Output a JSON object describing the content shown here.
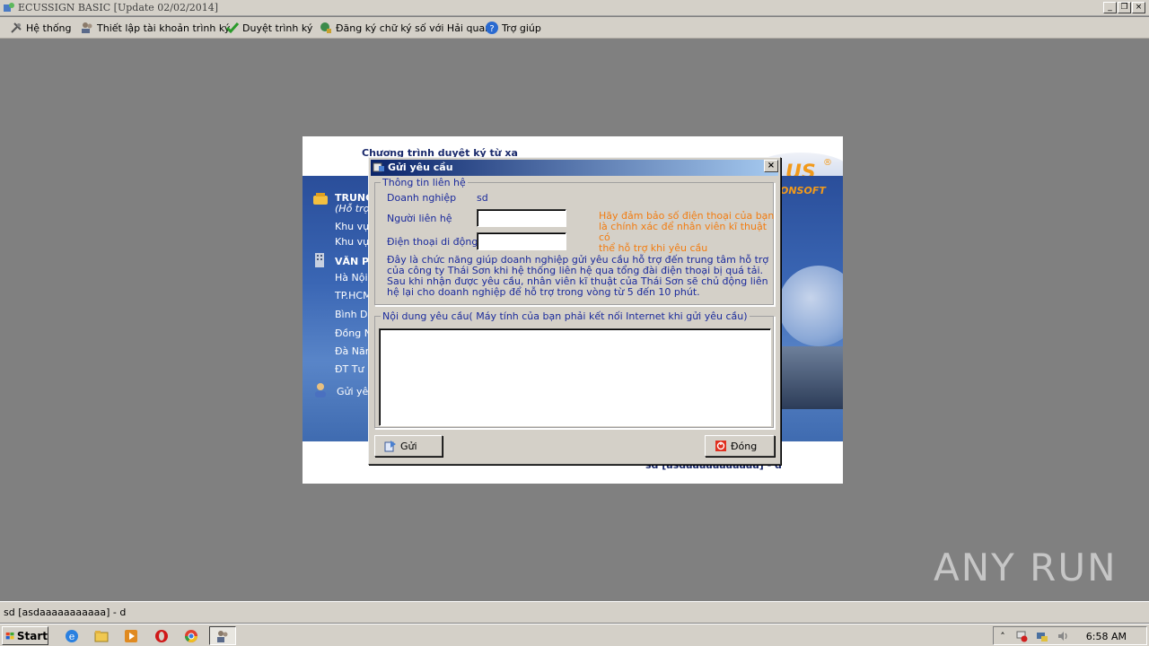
{
  "window": {
    "title": "ECUSSIGN BASIC [Update 02/02/2014]",
    "minimize_glyph": "_",
    "restore_glyph": "❐",
    "close_glyph": "×"
  },
  "menu": {
    "items": [
      {
        "label": "Hệ thống",
        "icon": "tools-icon"
      },
      {
        "label": "Thiết lập tài khoản trình ký",
        "icon": "users-icon"
      },
      {
        "label": "Duyệt trình ký",
        "icon": "check-icon"
      },
      {
        "label": "Đăng ký chữ ký số với Hải quan",
        "icon": "globe-key-icon"
      },
      {
        "label": "Trợ giúp",
        "icon": "help-icon"
      }
    ]
  },
  "splash": {
    "heading": "Chương trình duyệt ký từ xa",
    "logo": "US",
    "logo_sub": "ONSOFT",
    "logo_reg": "®",
    "sections": [
      {
        "label": "TRUNG",
        "bold": true
      },
      {
        "label": "(Hỗ trợ",
        "bold": false
      },
      {
        "label": "Khu vự",
        "bold": false
      },
      {
        "label": "Khu vự",
        "bold": false
      },
      {
        "label": "VĂN PH",
        "bold": true
      },
      {
        "label": "Hà Nội",
        "bold": false
      },
      {
        "label": "TP.HCM",
        "bold": false
      },
      {
        "label": "Bình D",
        "bold": false
      },
      {
        "label": "Đồng N",
        "bold": false
      },
      {
        "label": "Đà Năn",
        "bold": false
      },
      {
        "label": "ĐT Tư",
        "bold": false
      },
      {
        "label": "Gửi yêu",
        "bold": false
      }
    ],
    "footer": "sd [asdaaaaaaaaaaa] - d"
  },
  "dialog": {
    "title": "Gửi yêu cầu",
    "contact_group": "Thông tin liên hệ",
    "company_label": "Doanh nghiệp",
    "company_value": "sd",
    "contact_label": "Người liên hệ",
    "contact_value": "",
    "phone_label": "Điện thoại di động",
    "phone_value": "",
    "phone_note_lines": [
      "Hãy đảm bảo số điện thoại của bạn",
      "là chính xác để nhân viên kĩ thuật có",
      "thể hỗ trợ khi yêu cầu"
    ],
    "info_lines": [
      "Đây là chức năng giúp doanh nghiệp gửi yêu cầu hỗ trợ đến trung tâm hỗ trợ",
      "của công ty Thái Sơn khi hệ thống liên hệ qua tổng đài điện thoại bị quá tải.",
      "Sau khi nhận được yêu cầu, nhân viên kĩ thuật của Thái Sơn sẽ chủ động liên",
      "hệ lại cho doanh nghiệp để hỗ trợ trong vòng từ 5 đến 10 phút."
    ],
    "request_group": "Nội dung yêu cầu( Máy tính của bạn phải kết nối Internet khi gửi yêu cầu)",
    "request_value": "",
    "send_label": "Gửi",
    "close_label": "Đóng",
    "close_glyph": "×"
  },
  "statusbar": {
    "text": "sd [asdaaaaaaaaaaa] - d"
  },
  "taskbar": {
    "start_label": "Start",
    "clock": "6:58 AM",
    "pinned": [
      "ie-icon",
      "folder-icon",
      "media-player-icon",
      "opera-icon",
      "chrome-icon"
    ],
    "active": "ecussign-app-icon",
    "tray": [
      "arrow-up-icon",
      "flag-error-icon",
      "network-icon",
      "volume-icon"
    ]
  },
  "watermark": "ANY RUN"
}
